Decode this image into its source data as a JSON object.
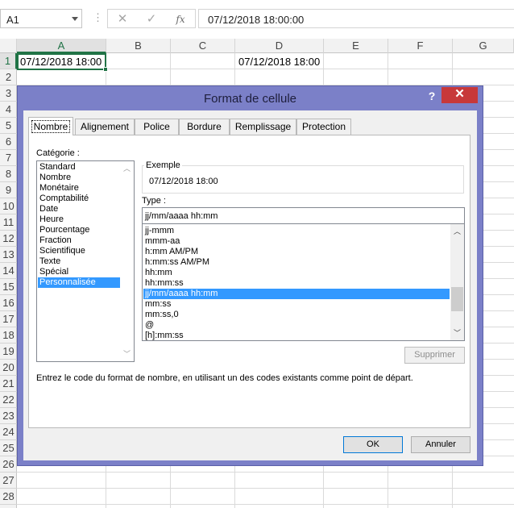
{
  "formula_bar": {
    "name_box": "A1",
    "dots": "⋮",
    "cancel_icon": "✕",
    "enter_icon": "✓",
    "fx_label": "fx",
    "formula": "07/12/2018  18:00:00"
  },
  "sheet": {
    "columns": [
      "A",
      "B",
      "C",
      "D",
      "E",
      "F",
      "G"
    ],
    "rows": [
      "1",
      "2",
      "3",
      "4",
      "5",
      "6",
      "7",
      "8",
      "9",
      "10",
      "11",
      "12",
      "13",
      "14",
      "15",
      "16",
      "17",
      "18",
      "19",
      "20",
      "21",
      "22",
      "23",
      "24",
      "25",
      "26",
      "27",
      "28"
    ],
    "cells": {
      "A1": "07/12/2018 18:00",
      "D1": "07/12/2018 18:00"
    }
  },
  "dialog": {
    "title": "Format de cellule",
    "help": "?",
    "close": "✕",
    "tabs": [
      "Nombre",
      "Alignement",
      "Police",
      "Bordure",
      "Remplissage",
      "Protection"
    ],
    "category_label": "Catégorie :",
    "categories": [
      "Standard",
      "Nombre",
      "Monétaire",
      "Comptabilité",
      "Date",
      "Heure",
      "Pourcentage",
      "Fraction",
      "Scientifique",
      "Texte",
      "Spécial",
      "Personnalisée"
    ],
    "selected_category": "Personnalisée",
    "example_label": "Exemple",
    "example_value": "07/12/2018 18:00",
    "type_label": "Type :",
    "type_value": "jj/mm/aaaa hh:mm",
    "formats": [
      "jj-mmm",
      "mmm-aa",
      "h:mm AM/PM",
      "h:mm:ss AM/PM",
      "hh:mm",
      "hh:mm:ss",
      "jj/mm/aaaa hh:mm",
      "mm:ss",
      "mm:ss,0",
      "@",
      "[h]:mm:ss"
    ],
    "selected_format": "jj/mm/aaaa hh:mm",
    "delete_button": "Supprimer",
    "help_text": "Entrez le code du format de nombre, en utilisant un des codes existants comme point de départ.",
    "ok_button": "OK",
    "cancel_button": "Annuler"
  },
  "colors": {
    "excel_green": "#217346",
    "dialog_frame": "#7b80c8",
    "selection_blue": "#3399ff",
    "close_red": "#c7383a"
  }
}
